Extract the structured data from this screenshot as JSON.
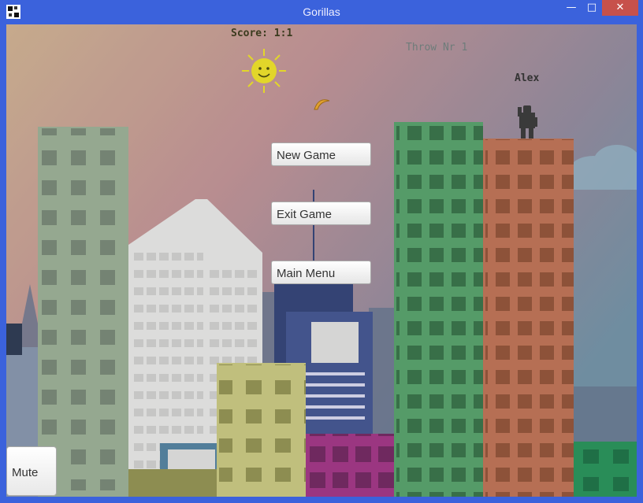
{
  "window": {
    "title": "Gorillas",
    "minimize_glyph": "—",
    "maximize_glyph": "□",
    "close_glyph": "✕"
  },
  "hud": {
    "score": "Score: 1:1",
    "throw": "Throw Nr 1",
    "player": "Alex"
  },
  "menu": {
    "new_game": "New Game",
    "exit_game": "Exit Game",
    "main_menu": "Main Menu"
  },
  "controls": {
    "mute": "Mute"
  },
  "icons": [
    "app-icon",
    "sun-icon",
    "banana-icon",
    "gorilla-icon",
    "cloud-icon"
  ],
  "colors": {
    "titlebar": "#3b62dc",
    "close": "#c7514b",
    "sun": "#e2d62a"
  }
}
